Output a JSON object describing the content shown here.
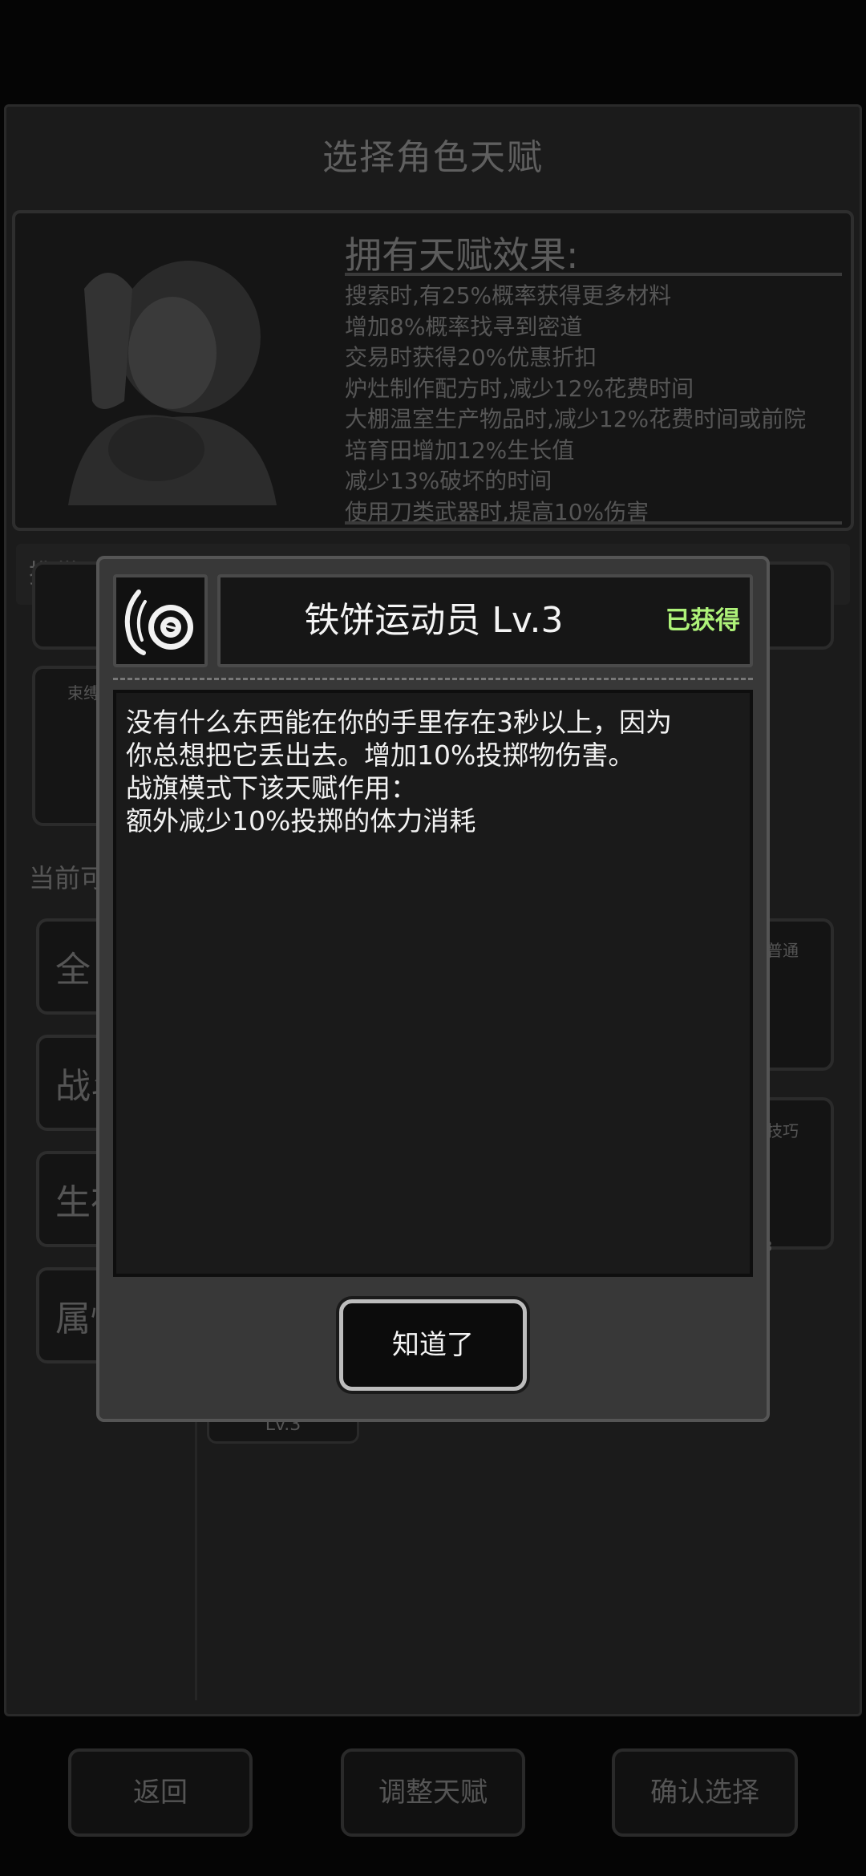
{
  "screen": {
    "title": "选择角色天赋"
  },
  "character_panel": {
    "effects_title": "拥有天赋效果:",
    "effects": [
      "搜索时,有25%概率获得更多材料",
      "增加8%概率找寻到密道",
      "交易时获得20%优惠折扣",
      "炉灶制作配方时,减少12%花费时间",
      "大棚温室生产物品时,减少12%花费时间或前院",
      "培育田增加12%生长值",
      "减少13%破坏的时间",
      "使用刀类武器时,提高10%伤害"
    ]
  },
  "carry_label": "携带天",
  "current_label": "当前可",
  "categories": [
    "全",
    "战斗",
    "生存",
    "属性"
  ],
  "grid": {
    "lv_tag": "Lv.3",
    "tag_common": "普通",
    "tag_skill": "技巧",
    "tag_bundle": "束缚",
    "tag_three": "3"
  },
  "bottom_buttons": {
    "back": "返回",
    "adjust": "调整天赋",
    "confirm": "确认选择"
  },
  "modal": {
    "icon": "discus-icon",
    "title": "铁饼运动员 Lv.3",
    "status": "已获得",
    "status_color": "#aef279",
    "description_lines": [
      "没有什么东西能在你的手里存在3秒以上，因为",
      "你总想把它丢出去。增加10%投掷物伤害。",
      "战旗模式下该天赋作用：",
      "额外减少10%投掷的体力消耗"
    ],
    "ok_button": "知道了"
  }
}
